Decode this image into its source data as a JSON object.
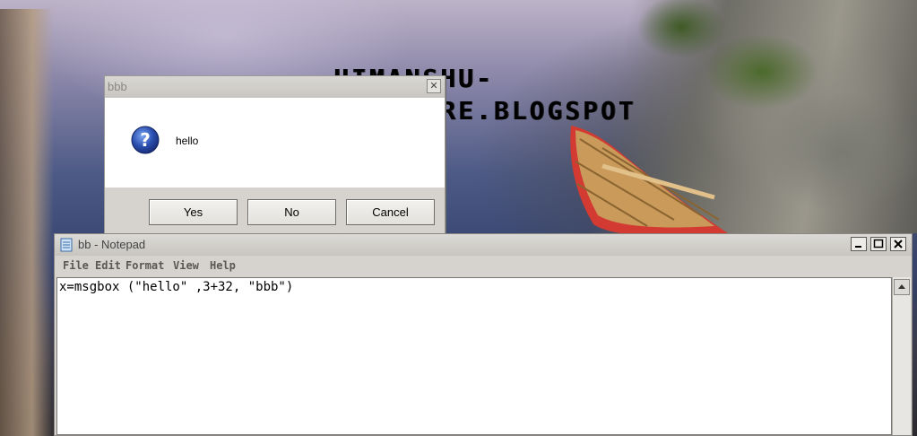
{
  "watermark": {
    "line1": "HIMANSHU-",
    "line2": "SOFTWARE.BLOGSPOT"
  },
  "message_box": {
    "title": "bbb",
    "message": "hello",
    "icon": "question-icon",
    "buttons": {
      "yes": "Yes",
      "no": "No",
      "cancel": "Cancel"
    }
  },
  "notepad": {
    "title": "bb - Notepad",
    "menu": {
      "file": "File",
      "edit": "Edit",
      "format": "Format",
      "view": "View",
      "help": "Help"
    },
    "content": "x=msgbox (\"hello\" ,3+32, \"bbb\")"
  },
  "colors": {
    "question_icon": "#2a4fb0",
    "msgbox_body": "#ffffff",
    "window_chrome": "#d6d3ce"
  }
}
